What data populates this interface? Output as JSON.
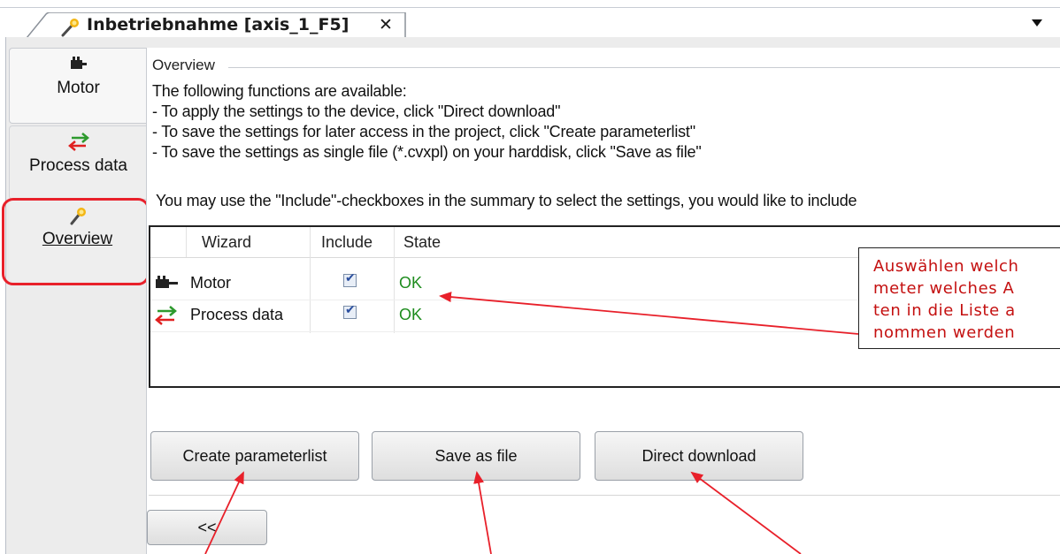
{
  "tab": {
    "title": "Inbetriebnahme [axis_1_F5]",
    "close": "✕"
  },
  "nav": [
    {
      "label": "Motor"
    },
    {
      "label": "Process data"
    },
    {
      "label": "Overview"
    }
  ],
  "overview": {
    "legend": "Overview",
    "intro": [
      "The following functions are available:",
      " - To apply the settings to the device, click \"Direct download\"",
      " - To save the settings for later access in the project, click \"Create parameterlist\"",
      " - To save the settings as single file (*.cvxpl) on your harddisk, click \"Save as file\"",
      "You may use the \"Include\"-checkboxes in the summary to select the settings, you would like to include"
    ]
  },
  "table": {
    "headers": [
      "Wizard",
      "Include",
      "State"
    ],
    "rows": [
      {
        "wizard": "Motor",
        "include": true,
        "state": "OK"
      },
      {
        "wizard": "Process data",
        "include": true,
        "state": "OK"
      }
    ]
  },
  "annotation": {
    "lines": [
      "Auswählen welch",
      "meter welches A",
      "ten in die Liste a",
      "nommen werden"
    ]
  },
  "buttons": {
    "create": "Create parameterlist",
    "save": "Save as file",
    "download": "Direct download",
    "back": "<<"
  },
  "colors": {
    "highlight": "#e8202a",
    "annotation_text": "#c41010",
    "state_ok": "#1e8c1e"
  },
  "icons": {
    "tab": "magic-wand-icon",
    "motor": "motor-icon",
    "process": "swap-arrows-icon",
    "overview": "magic-wand-icon"
  }
}
